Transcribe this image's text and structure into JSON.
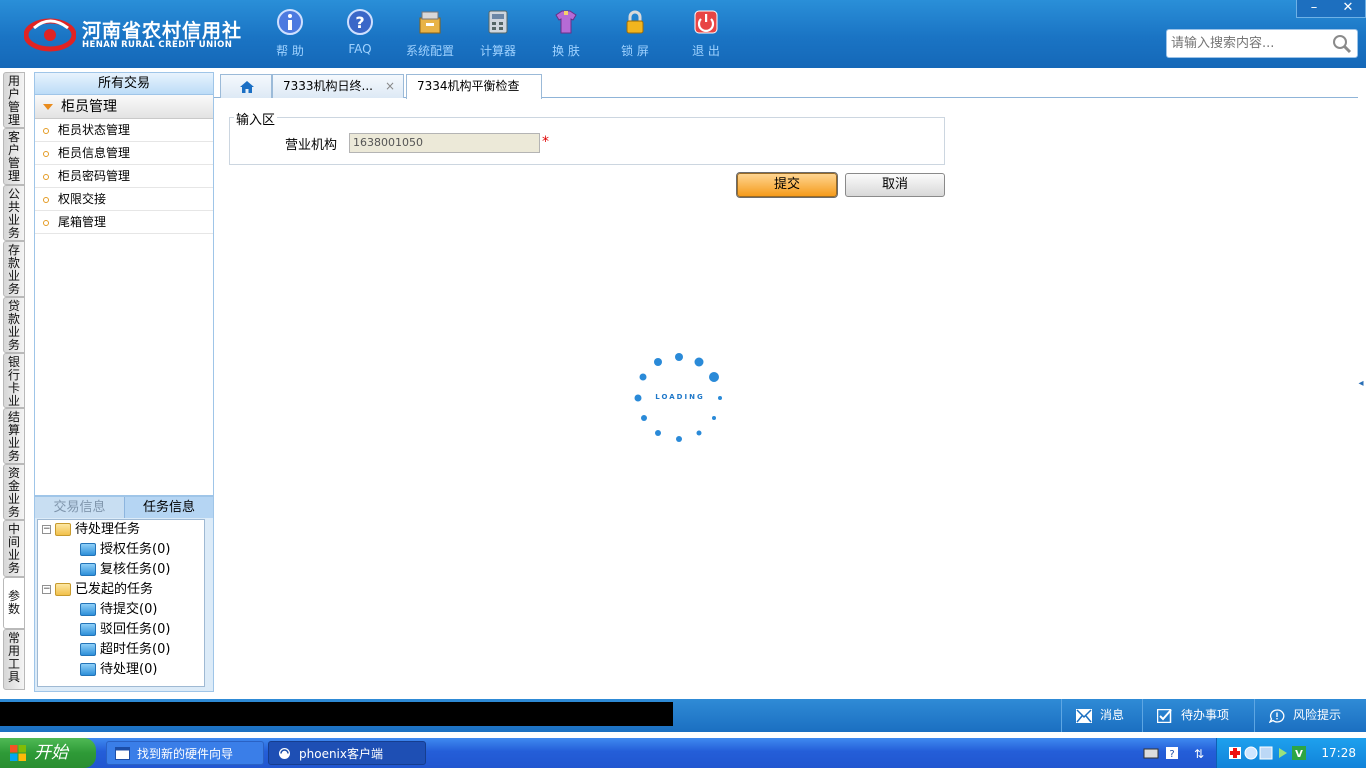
{
  "header": {
    "logo_cn": "河南省农村信用社",
    "logo_en": "HENAN RURAL CREDIT UNION",
    "tools": [
      {
        "label": "帮 助",
        "icon": "info-icon"
      },
      {
        "label": "FAQ",
        "icon": "question-icon"
      },
      {
        "label": "系统配置",
        "icon": "config-icon"
      },
      {
        "label": "计算器",
        "icon": "calculator-icon"
      },
      {
        "label": "换 肤",
        "icon": "skin-icon"
      },
      {
        "label": "锁 屏",
        "icon": "lock-icon"
      },
      {
        "label": "退 出",
        "icon": "power-icon"
      }
    ],
    "minimize": "–",
    "close": "✕",
    "search_placeholder": "请输入搜索内容..."
  },
  "vtabs": [
    "用户管理",
    "客户管理",
    "公共业务",
    "存款业务",
    "贷款业务",
    "银行卡业务",
    "结算业务",
    "资金业务",
    "中间业务",
    "参数",
    "常用工具"
  ],
  "nav": {
    "header": "所有交易",
    "group": "柜员管理",
    "items": [
      "柜员状态管理",
      "柜员信息管理",
      "柜员密码管理",
      "权限交接",
      "尾箱管理"
    ]
  },
  "tasks": {
    "tab_trade": "交易信息",
    "tab_task": "任务信息",
    "tree": [
      {
        "label": "待处理任务",
        "type": "group"
      },
      {
        "label": "授权任务(0)",
        "type": "leaf"
      },
      {
        "label": "复核任务(0)",
        "type": "leaf"
      },
      {
        "label": "已发起的任务",
        "type": "group"
      },
      {
        "label": "待提交(0)",
        "type": "leaf"
      },
      {
        "label": "驳回任务(0)",
        "type": "leaf"
      },
      {
        "label": "超时任务(0)",
        "type": "leaf"
      },
      {
        "label": "待处理(0)",
        "type": "leaf"
      }
    ]
  },
  "tabs": {
    "tab1": "7333机构日终...",
    "tab1_close": "×",
    "tab2": "7334机构平衡检查"
  },
  "form": {
    "legend": "输入区",
    "org_label": "营业机构",
    "org_value": "1638001050",
    "required": "*",
    "submit": "提交",
    "cancel": "取消"
  },
  "loading": "LOADING",
  "statusbar": {
    "message": "消息",
    "todo": "待办事项",
    "risk": "风险提示"
  },
  "taskbar": {
    "start": "开始",
    "task1": "找到新的硬件向导",
    "task2": "phoenix客户端",
    "clock": "17:28"
  },
  "colors": {
    "header_blue": "#1a74c4",
    "accent_orange": "#f59b1c",
    "required_red": "#e00000",
    "loading_blue": "#1f78c9"
  }
}
